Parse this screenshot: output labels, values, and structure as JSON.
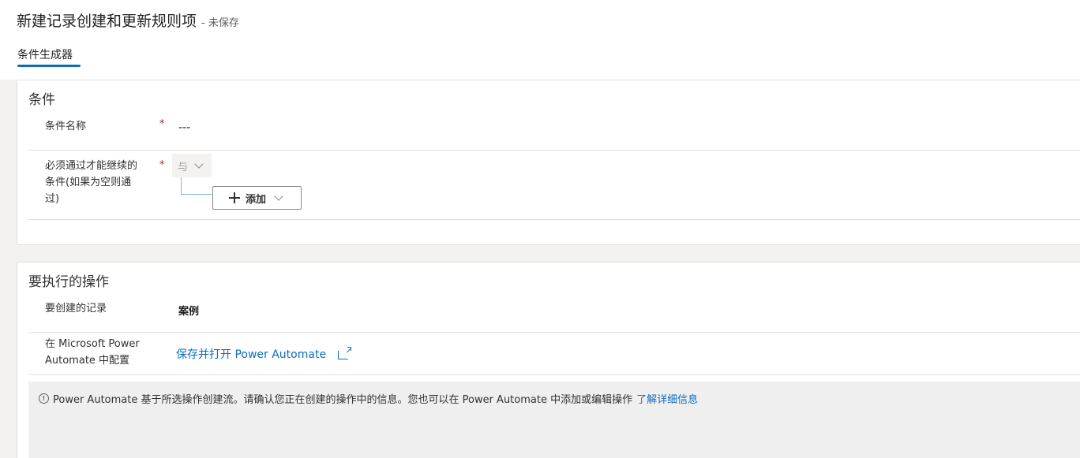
{
  "header": {
    "title": "新建记录创建和更新规则项",
    "save_state": "- 未保存",
    "tabs": [
      {
        "label": "条件生成器",
        "selected": true
      }
    ]
  },
  "conditions_section": {
    "title": "条件",
    "condition_name": {
      "label": "条件名称",
      "required_mark": "*",
      "value": "---"
    },
    "must_pass": {
      "label_line1": "必须通过才能继续的",
      "label_line2": "条件(如果为空则通",
      "label_line3": "过)",
      "required_mark": "*",
      "operator_dropdown": {
        "value": "与",
        "icon": "chevron-down-icon"
      },
      "add_button": {
        "label": "添加",
        "icon": "plus-icon"
      }
    }
  },
  "actions_section": {
    "title": "要执行的操作",
    "record_to_create": {
      "label": "要创建的记录",
      "value": "案例"
    },
    "configure": {
      "label_line1": "在 Microsoft Power",
      "label_line2": "Automate 中配置",
      "link_label": "保存并打开 Power Automate",
      "link_icon": "external-link-icon"
    },
    "info": {
      "icon": "info-icon",
      "icon_glyph": "!",
      "text": "Power Automate 基于所选操作创建流。请确认您正在创建的操作中的信息。您也可以在 Power Automate 中添加或编辑操作",
      "learn_more": "了解详细信息"
    }
  },
  "colors": {
    "accent": "#0f6cbd",
    "required": "#a4262c",
    "background": "#f3f2f1"
  }
}
